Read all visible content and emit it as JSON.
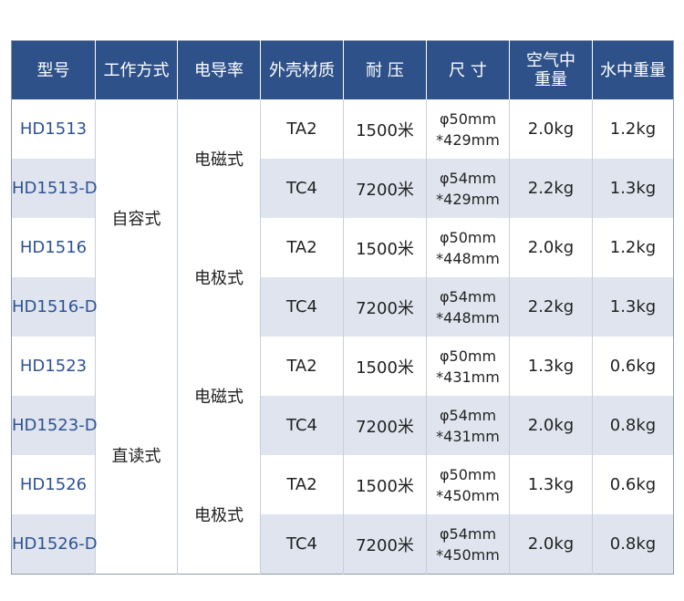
{
  "headers": {
    "model": "型号",
    "working_mode": "工作方式",
    "conductivity": "电导率",
    "shell_material": "外壳材质",
    "pressure": "耐 压",
    "size": "尺 寸",
    "air_weight_line1": "空气中",
    "air_weight_line2": "重量",
    "water_weight": "水中重量"
  },
  "working_modes": [
    "自容式",
    "直读式"
  ],
  "conductivity_types": [
    "电磁式",
    "电极式",
    "电磁式",
    "电极式"
  ],
  "rows": [
    {
      "model": "HD1513",
      "material": "TA2",
      "pressure": "1500米",
      "size_diameter": "φ50mm",
      "size_length": "*429mm",
      "air_weight": "2.0kg",
      "water_weight": "1.2kg"
    },
    {
      "model": "HD1513-D",
      "material": "TC4",
      "pressure": "7200米",
      "size_diameter": "φ54mm",
      "size_length": "*429mm",
      "air_weight": "2.2kg",
      "water_weight": "1.3kg"
    },
    {
      "model": "HD1516",
      "material": "TA2",
      "pressure": "1500米",
      "size_diameter": "φ50mm",
      "size_length": "*448mm",
      "air_weight": "2.0kg",
      "water_weight": "1.2kg"
    },
    {
      "model": "HD1516-D",
      "material": "TC4",
      "pressure": "7200米",
      "size_diameter": "φ54mm",
      "size_length": "*448mm",
      "air_weight": "2.2kg",
      "water_weight": "1.3kg"
    },
    {
      "model": "HD1523",
      "material": "TA2",
      "pressure": "1500米",
      "size_diameter": "φ50mm",
      "size_length": "*431mm",
      "air_weight": "1.3kg",
      "water_weight": "0.6kg"
    },
    {
      "model": "HD1523-D",
      "material": "TC4",
      "pressure": "7200米",
      "size_diameter": "φ54mm",
      "size_length": "*431mm",
      "air_weight": "2.0kg",
      "water_weight": "0.8kg"
    },
    {
      "model": "HD1526",
      "material": "TA2",
      "pressure": "1500米",
      "size_diameter": "φ50mm",
      "size_length": "*450mm",
      "air_weight": "1.3kg",
      "water_weight": "0.6kg"
    },
    {
      "model": "HD1526-D",
      "material": "TC4",
      "pressure": "7200米",
      "size_diameter": "φ54mm",
      "size_length": "*450mm",
      "air_weight": "2.0kg",
      "water_weight": "0.8kg"
    }
  ],
  "colors": {
    "header_bg": "#2e5189",
    "header_text": "#ffffff",
    "stripe": "#dfe4ee",
    "model_text": "#2f5394"
  }
}
